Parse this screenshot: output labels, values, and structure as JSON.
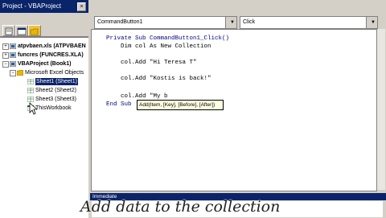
{
  "project_pane": {
    "title": "Project - VBAProject",
    "close_glyph": "×",
    "tree": [
      {
        "label": "atpvbaen.xls (ATPVBAEN",
        "expander": "+"
      },
      {
        "label": "funcres (FUNCRES.XLA)",
        "expander": "+"
      },
      {
        "label": "VBAProject (Book1)",
        "expander": "−"
      },
      {
        "label": "Microsoft Excel Objects",
        "expander": "−"
      },
      {
        "label": "Sheet1 (Sheet1)",
        "selected": true
      },
      {
        "label": "Sheet2 (Sheet2)"
      },
      {
        "label": "Sheet3 (Sheet3)"
      },
      {
        "label": "ThisWorkbook"
      }
    ]
  },
  "code_window": {
    "object_combo": "CommandButton1",
    "procedure_combo": "Click",
    "combo_arrow": "▼",
    "lines": [
      "Private Sub CommandButton1_Click()",
      "    Dim col As New Collection",
      "",
      "    col.Add \"Hi Teresa T\"",
      "",
      "    col.Add \"Kostis is back!\"",
      "",
      "    col.Add \"My b",
      "End Sub"
    ],
    "tooltip": "Add(Item, [Key], [Before], [After])"
  },
  "immediate": {
    "title": "Immediate"
  },
  "caption": "Add data to the collection"
}
